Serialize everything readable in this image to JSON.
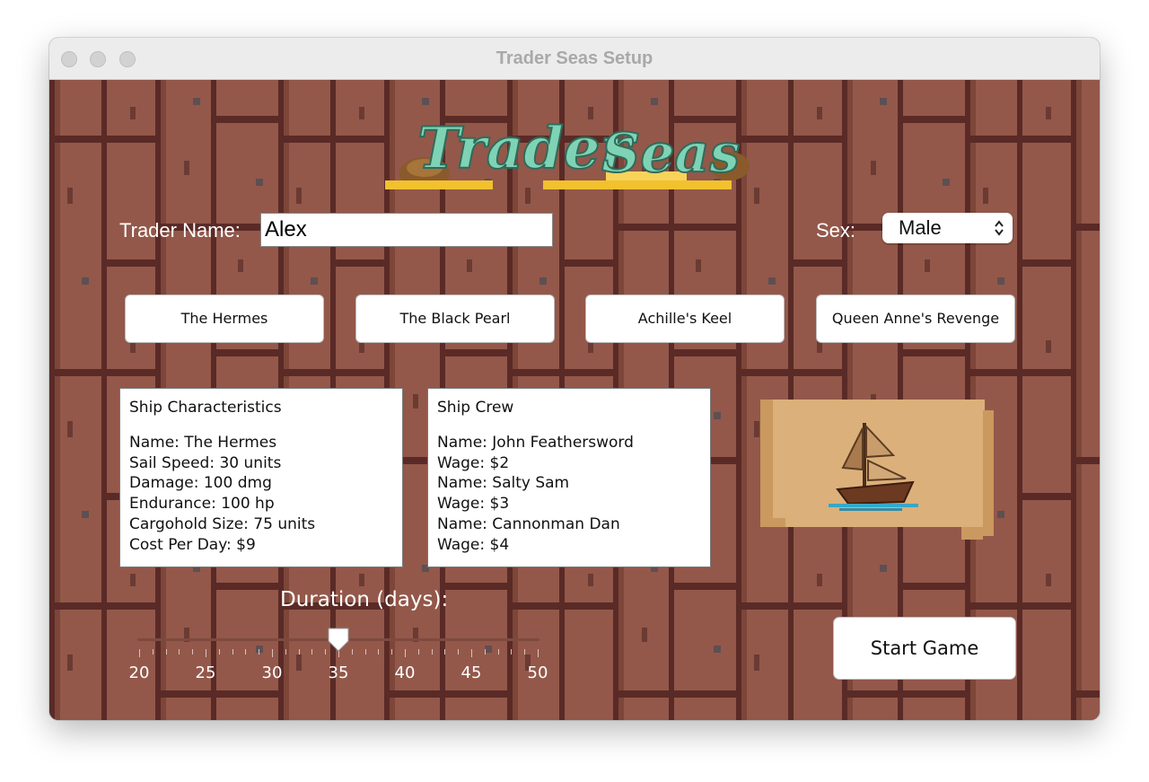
{
  "window": {
    "title": "Trader Seas Setup"
  },
  "logo": {
    "text": "Trader Seas"
  },
  "trader": {
    "name_label": "Trader Name:",
    "name_value": "Alex"
  },
  "sex": {
    "label": "Sex:",
    "selected": "Male"
  },
  "ships": [
    "The Hermes",
    "The Black Pearl",
    "Achille's Keel",
    "Queen Anne's Revenge"
  ],
  "characteristics": {
    "title": "Ship Characteristics",
    "lines": [
      "Name: The Hermes",
      "Sail Speed: 30 units",
      "Damage: 100 dmg",
      "Endurance: 100 hp",
      "Cargohold Size: 75 units",
      "Cost Per Day: $9"
    ]
  },
  "crew": {
    "title": "Ship Crew",
    "lines": [
      "Name: John Feathersword",
      "Wage: $2",
      "Name: Salty Sam",
      "Wage: $3",
      "Name: Cannonman Dan",
      "Wage: $4"
    ]
  },
  "duration": {
    "label": "Duration (days):",
    "min": 20,
    "max": 50,
    "value": 35,
    "tick_labels": [
      "20",
      "25",
      "30",
      "35",
      "40",
      "45",
      "50"
    ]
  },
  "start_button": "Start Game"
}
